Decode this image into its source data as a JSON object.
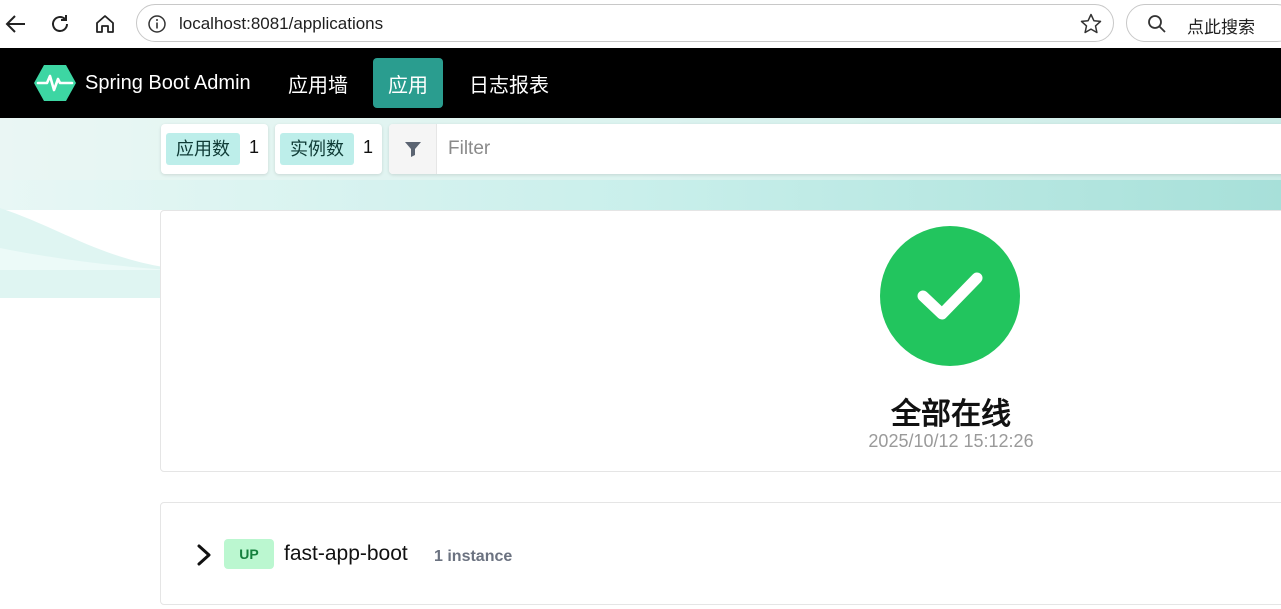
{
  "browser": {
    "url": "localhost:8081/applications",
    "search_placeholder": "点此搜索"
  },
  "header": {
    "brand": "Spring Boot Admin",
    "nav": [
      {
        "label": "应用墙",
        "active": false
      },
      {
        "label": "应用",
        "active": true
      },
      {
        "label": "日志报表",
        "active": false
      }
    ],
    "accent": "#2a9d8f"
  },
  "toolbar": {
    "app_count_label": "应用数",
    "app_count": "1",
    "instance_count_label": "实例数",
    "instance_count": "1",
    "filter_placeholder": "Filter"
  },
  "status": {
    "icon": "check-circle-icon",
    "title": "全部在线",
    "timestamp": "2025/10/12 15:12:26",
    "color": "#22c55e"
  },
  "applications": [
    {
      "status": "UP",
      "name": "fast-app-boot",
      "instances": "1 instance"
    }
  ]
}
